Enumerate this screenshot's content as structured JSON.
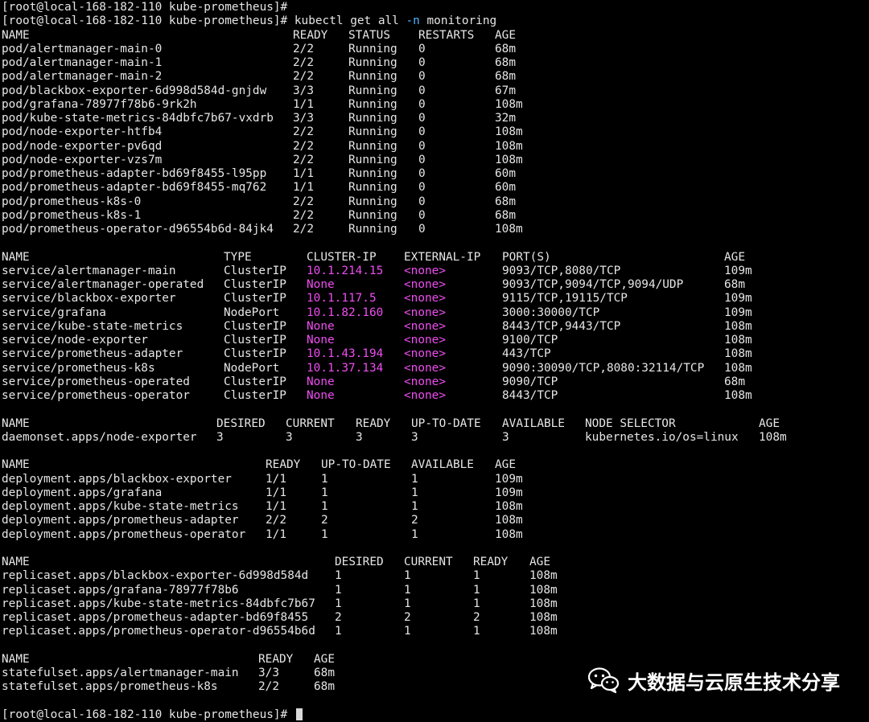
{
  "prompt_start": "[root@local-168-182-110 kube-prometheus]# ",
  "command": {
    "part1": "kubectl get all ",
    "flag": "-n",
    "part2": " monitoring"
  },
  "pods": {
    "headers": [
      "NAME",
      "READY",
      "STATUS",
      "RESTARTS",
      "AGE"
    ],
    "rows": [
      [
        "pod/alertmanager-main-0",
        "2/2",
        "Running",
        "0",
        "68m"
      ],
      [
        "pod/alertmanager-main-1",
        "2/2",
        "Running",
        "0",
        "68m"
      ],
      [
        "pod/alertmanager-main-2",
        "2/2",
        "Running",
        "0",
        "68m"
      ],
      [
        "pod/blackbox-exporter-6d998d584d-gnjdw",
        "3/3",
        "Running",
        "0",
        "67m"
      ],
      [
        "pod/grafana-78977f78b6-9rk2h",
        "1/1",
        "Running",
        "0",
        "108m"
      ],
      [
        "pod/kube-state-metrics-84dbfc7b67-vxdrb",
        "3/3",
        "Running",
        "0",
        "32m"
      ],
      [
        "pod/node-exporter-htfb4",
        "2/2",
        "Running",
        "0",
        "108m"
      ],
      [
        "pod/node-exporter-pv6qd",
        "2/2",
        "Running",
        "0",
        "108m"
      ],
      [
        "pod/node-exporter-vzs7m",
        "2/2",
        "Running",
        "0",
        "108m"
      ],
      [
        "pod/prometheus-adapter-bd69f8455-l95pp",
        "1/1",
        "Running",
        "0",
        "60m"
      ],
      [
        "pod/prometheus-adapter-bd69f8455-mq762",
        "1/1",
        "Running",
        "0",
        "60m"
      ],
      [
        "pod/prometheus-k8s-0",
        "2/2",
        "Running",
        "0",
        "68m"
      ],
      [
        "pod/prometheus-k8s-1",
        "2/2",
        "Running",
        "0",
        "68m"
      ],
      [
        "pod/prometheus-operator-d96554b6d-84jk4",
        "2/2",
        "Running",
        "0",
        "108m"
      ]
    ]
  },
  "services": {
    "headers": [
      "NAME",
      "TYPE",
      "CLUSTER-IP",
      "EXTERNAL-IP",
      "PORT(S)",
      "AGE"
    ],
    "rows": [
      [
        "service/alertmanager-main",
        "ClusterIP",
        "10.1.214.15",
        "<none>",
        "9093/TCP,8080/TCP",
        "109m"
      ],
      [
        "service/alertmanager-operated",
        "ClusterIP",
        "None",
        "<none>",
        "9093/TCP,9094/TCP,9094/UDP",
        "68m"
      ],
      [
        "service/blackbox-exporter",
        "ClusterIP",
        "10.1.117.5",
        "<none>",
        "9115/TCP,19115/TCP",
        "109m"
      ],
      [
        "service/grafana",
        "NodePort",
        "10.1.82.160",
        "<none>",
        "3000:30000/TCP",
        "109m"
      ],
      [
        "service/kube-state-metrics",
        "ClusterIP",
        "None",
        "<none>",
        "8443/TCP,9443/TCP",
        "108m"
      ],
      [
        "service/node-exporter",
        "ClusterIP",
        "None",
        "<none>",
        "9100/TCP",
        "108m"
      ],
      [
        "service/prometheus-adapter",
        "ClusterIP",
        "10.1.43.194",
        "<none>",
        "443/TCP",
        "108m"
      ],
      [
        "service/prometheus-k8s",
        "NodePort",
        "10.1.37.134",
        "<none>",
        "9090:30090/TCP,8080:32114/TCP",
        "108m"
      ],
      [
        "service/prometheus-operated",
        "ClusterIP",
        "None",
        "<none>",
        "9090/TCP",
        "68m"
      ],
      [
        "service/prometheus-operator",
        "ClusterIP",
        "None",
        "<none>",
        "8443/TCP",
        "108m"
      ]
    ]
  },
  "daemonsets": {
    "headers": [
      "NAME",
      "DESIRED",
      "CURRENT",
      "READY",
      "UP-TO-DATE",
      "AVAILABLE",
      "NODE SELECTOR",
      "AGE"
    ],
    "rows": [
      [
        "daemonset.apps/node-exporter",
        "3",
        "3",
        "3",
        "3",
        "3",
        "kubernetes.io/os=linux",
        "108m"
      ]
    ]
  },
  "deployments": {
    "headers": [
      "NAME",
      "READY",
      "UP-TO-DATE",
      "AVAILABLE",
      "AGE"
    ],
    "rows": [
      [
        "deployment.apps/blackbox-exporter",
        "1/1",
        "1",
        "1",
        "109m"
      ],
      [
        "deployment.apps/grafana",
        "1/1",
        "1",
        "1",
        "109m"
      ],
      [
        "deployment.apps/kube-state-metrics",
        "1/1",
        "1",
        "1",
        "108m"
      ],
      [
        "deployment.apps/prometheus-adapter",
        "2/2",
        "2",
        "2",
        "108m"
      ],
      [
        "deployment.apps/prometheus-operator",
        "1/1",
        "1",
        "1",
        "108m"
      ]
    ]
  },
  "replicasets": {
    "headers": [
      "NAME",
      "DESIRED",
      "CURRENT",
      "READY",
      "AGE"
    ],
    "rows": [
      [
        "replicaset.apps/blackbox-exporter-6d998d584d",
        "1",
        "1",
        "1",
        "108m"
      ],
      [
        "replicaset.apps/grafana-78977f78b6",
        "1",
        "1",
        "1",
        "108m"
      ],
      [
        "replicaset.apps/kube-state-metrics-84dbfc7b67",
        "1",
        "1",
        "1",
        "108m"
      ],
      [
        "replicaset.apps/prometheus-adapter-bd69f8455",
        "2",
        "2",
        "2",
        "108m"
      ],
      [
        "replicaset.apps/prometheus-operator-d96554b6d",
        "1",
        "1",
        "1",
        "108m"
      ]
    ]
  },
  "statefulsets": {
    "headers": [
      "NAME",
      "READY",
      "AGE"
    ],
    "rows": [
      [
        "statefulset.apps/alertmanager-main",
        "3/3",
        "68m"
      ],
      [
        "statefulset.apps/prometheus-k8s",
        "2/2",
        "68m"
      ]
    ]
  },
  "watermark": {
    "text": "大数据与云原生技术分享",
    "icon": "wechat-icon"
  },
  "colors": {
    "background": "#000000",
    "text": "#e6e6e6",
    "ip_highlight": "#ef4df1",
    "flag_highlight": "#4fb5ff"
  }
}
